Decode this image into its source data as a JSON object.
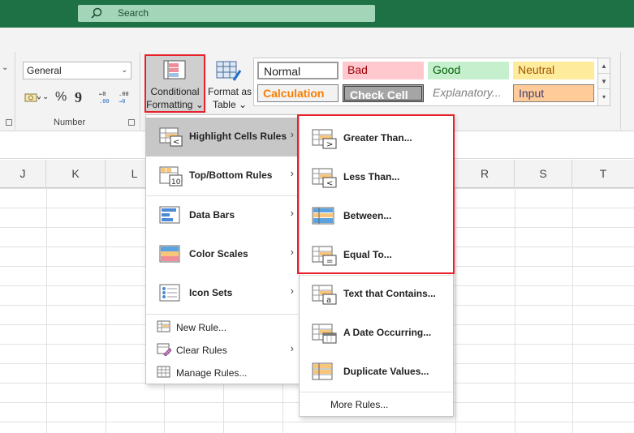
{
  "search": {
    "label": "Search"
  },
  "number_group": {
    "format_value": "General",
    "label": "Number",
    "percent": "%",
    "comma": "9"
  },
  "buttons": {
    "conditional_formatting": [
      "Conditional",
      "Formatting"
    ],
    "format_as_table": [
      "Format as",
      "Table"
    ]
  },
  "styles": [
    {
      "name": "Normal",
      "fg": "#222222",
      "bg": "#ffffff"
    },
    {
      "name": "Bad",
      "fg": "#9c0006",
      "bg": "#ffc7ce"
    },
    {
      "name": "Good",
      "fg": "#006100",
      "bg": "#c6efce"
    },
    {
      "name": "Neutral",
      "fg": "#9c5700",
      "bg": "#ffeb9c"
    },
    {
      "name": "Calculation",
      "fg": "#fa7d00",
      "bg": "#f2f2f2"
    },
    {
      "name": "Check Cell",
      "fg": "#ffffff",
      "bg": "#a5a5a5"
    },
    {
      "name": "Explanatory...",
      "fg": "#7f7f7f",
      "bg": "#ffffff"
    },
    {
      "name": "Input",
      "fg": "#3f3f76",
      "bg": "#ffcc99"
    }
  ],
  "columns": [
    "J",
    "K",
    "L",
    "R",
    "S",
    "T"
  ],
  "menu": {
    "items": [
      {
        "label": "Highlight Cells Rules",
        "icon": "highlight-cells-icon"
      },
      {
        "label": "Top/Bottom Rules",
        "icon": "top-bottom-icon"
      },
      {
        "label": "Data Bars",
        "icon": "data-bars-icon"
      },
      {
        "label": "Color Scales",
        "icon": "color-scales-icon"
      },
      {
        "label": "Icon Sets",
        "icon": "icon-sets-icon"
      }
    ],
    "actions": [
      {
        "label": "New Rule...",
        "icon": "new-rule-icon"
      },
      {
        "label": "Clear Rules",
        "icon": "clear-rules-icon"
      },
      {
        "label": "Manage Rules...",
        "icon": "manage-rules-icon"
      }
    ]
  },
  "submenu": {
    "items": [
      {
        "label": "Greater Than...",
        "icon": "greater-than-icon"
      },
      {
        "label": "Less Than...",
        "icon": "less-than-icon"
      },
      {
        "label": "Between...",
        "icon": "between-icon"
      },
      {
        "label": "Equal To...",
        "icon": "equal-to-icon"
      },
      {
        "label": "Text that Contains...",
        "icon": "text-contains-icon"
      },
      {
        "label": "A Date Occurring...",
        "icon": "date-occurring-icon"
      },
      {
        "label": "Duplicate Values...",
        "icon": "duplicate-values-icon"
      }
    ],
    "more": "More Rules..."
  },
  "colors": {
    "accent_green": "#1e7145",
    "highlight_red": "#e8202a"
  }
}
